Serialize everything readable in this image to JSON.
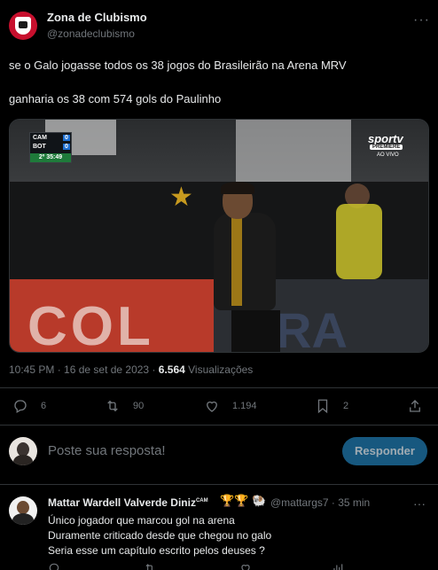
{
  "post": {
    "author_name": "Zona de Clubismo",
    "author_handle": "@zonadeclubismo",
    "more": "···",
    "text_line1": "se o Galo jogasse todos os 38 jogos do Brasileirão na Arena MRV",
    "text_line2": "ganharia os 38 com 574 gols do Paulinho",
    "time": "10:45 PM · 16 de set de 2023 · ",
    "views_count": "6.564",
    "views_label": " Visualizações",
    "replies": "6",
    "reposts": "90",
    "likes": "1.194",
    "bookmarks": "2"
  },
  "media": {
    "scoreboard": {
      "team1": "CAM",
      "score1": "0",
      "team2": "BOT",
      "score2": "0",
      "clock": "2º 35:49"
    },
    "brand": "sportv",
    "brand_sub": "PREMIERE",
    "brand_live": "AO VIVO",
    "board_text_left": "COL",
    "board_text_right": "RA"
  },
  "composer": {
    "placeholder": "Poste sua resposta!",
    "button": "Responder"
  },
  "reply": {
    "name": "Mattar Wardell Valverde Diniz",
    "badge": "CAM",
    "emojis": "🏆🏆 🐏",
    "handle": "@mattargs7 · 35 min",
    "lines": [
      "Único jogador que marcou gol na arena",
      "Duramente criticado desde que chegou no galo",
      "Seria esse um capítulo escrito pelos deuses ?"
    ]
  },
  "colors": {
    "accent": "#1d9bf0",
    "muted": "#71767b",
    "divider": "#2f3336"
  }
}
